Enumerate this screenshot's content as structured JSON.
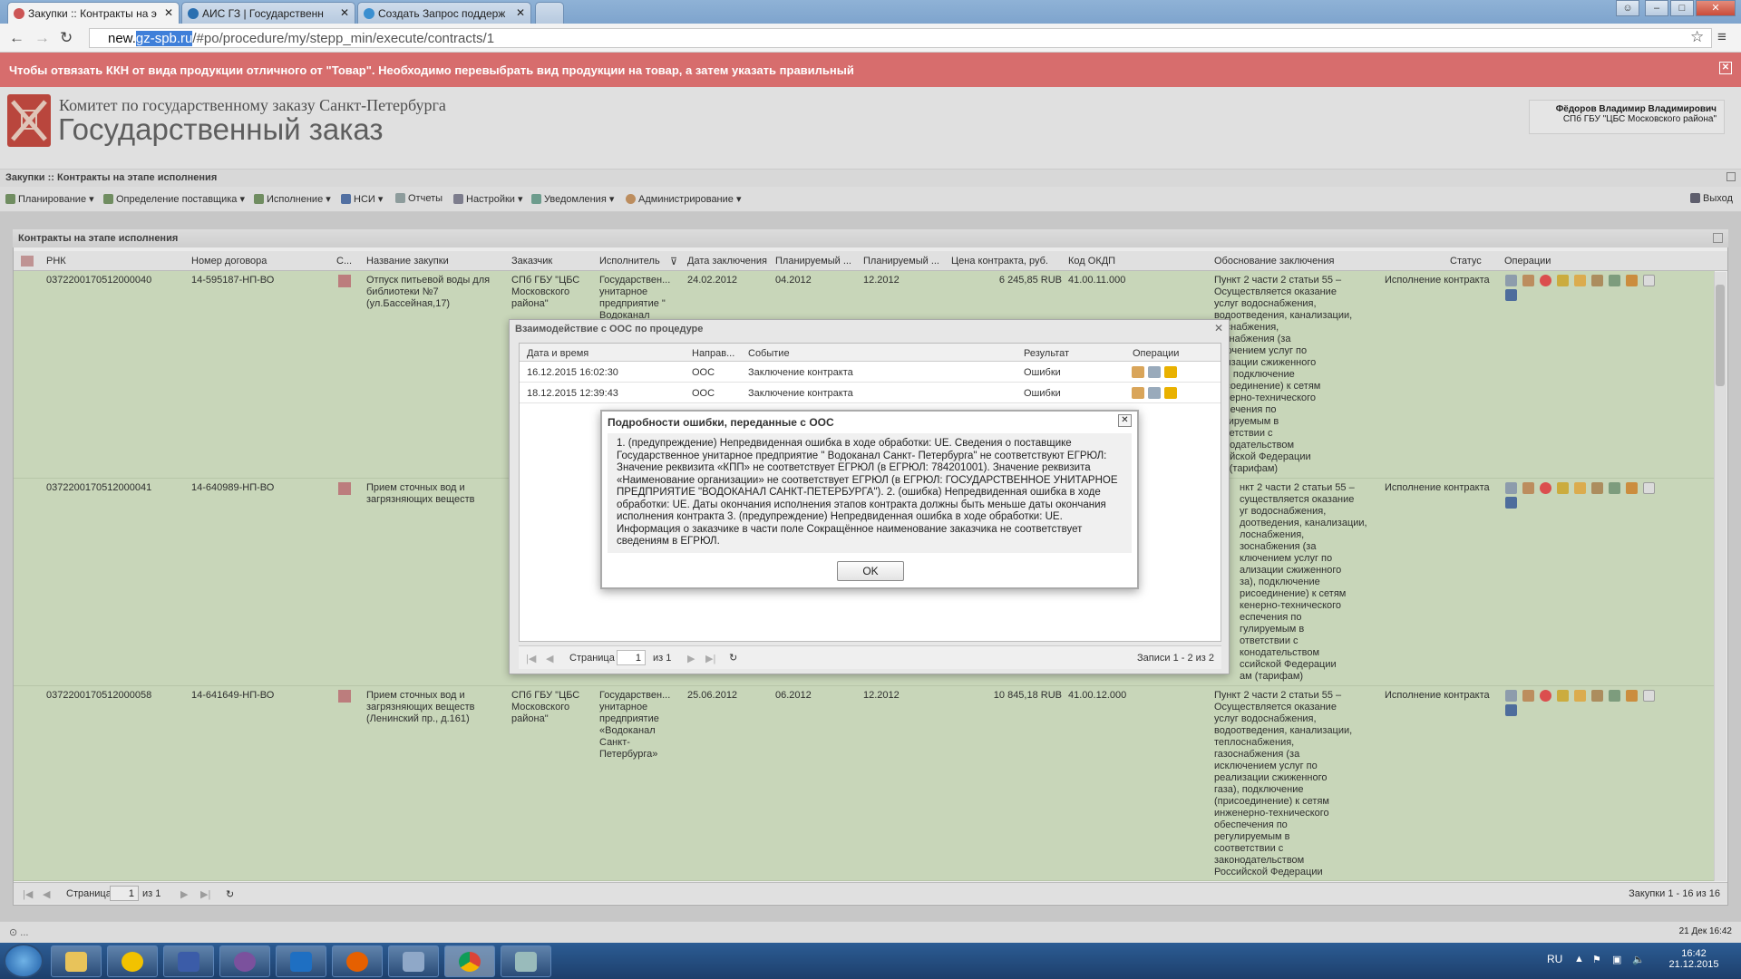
{
  "browser": {
    "tabs": [
      {
        "title": "Закупки :: Контракты на э",
        "active": true
      },
      {
        "title": "АИС ГЗ | Государственн",
        "active": false
      },
      {
        "title": "Создать Запрос поддерж",
        "active": false
      }
    ],
    "url_prefix": "new.",
    "url_highlight": "gz-spb.ru",
    "url_rest": "/#po/procedure/my/stepp_min/execute/contracts/1"
  },
  "alert": {
    "text": "Чтобы отвязать ККН от вида продукции отличного от \"Товар\". Необходимо перевыбрать вид продукции на товар, а затем указать правильный"
  },
  "header": {
    "org_line1": "Комитет по государственному заказу Санкт-Петербурга",
    "org_line2": "Государственный заказ",
    "user_name": "Фёдоров Владимир Владимирович",
    "user_org": "СПб ГБУ \"ЦБС Московского района\""
  },
  "page_title": "Закупки :: Контракты на этапе исполнения",
  "menu": {
    "items": [
      "Планирование",
      "Определение поставщика",
      "Исполнение",
      "НСИ",
      "Отчеты",
      "Настройки",
      "Уведомления",
      "Администрирование"
    ],
    "exit": "Выход"
  },
  "grid": {
    "title": "Контракты на этапе исполнения",
    "columns": [
      "РНК",
      "Номер договора",
      "С...",
      "Название закупки",
      "Заказчик",
      "Исполнитель",
      "Дата заключения",
      "Планируемый ...",
      "Планируемый ...",
      "Цена контракта, руб.",
      "Код ОКДП",
      "Обоснование заключения",
      "Статус",
      "Операции"
    ],
    "rows": [
      {
        "rnk": "0372200170512000040",
        "contract_no": "14-595187-НП-ВО",
        "name": "Отпуск питьевой воды для\nбиблиотеки №7\n(ул.Бассейная,17)",
        "customer": "СПб ГБУ \"ЦБС\nМосковского\nрайона\"",
        "executor": "Государствен...\nунитарное\nпредприятие \"\nВодоканал",
        "date": "24.02.2012",
        "plan1": "04.2012",
        "plan2": "12.2012",
        "price": "6 245,85 RUB",
        "okdp": "41.00.11.000",
        "basis": "Пункт 2 части 2 статьи 55 –\nОсуществляется оказание\nуслуг водоснабжения,\nводоотведения, канализации,\nлоснабжения,\nзоснабжения (за\nключением услуг по\nализации сжиженного\nза), подключение\nрисоединение) к сетям\nкенерно-технического\nеспечения по\nгулируемым в\nответствии с\nконодательством\nссийской Федерации\nам (тарифам)",
        "status": "Исполнение контракта"
      },
      {
        "rnk": "0372200170512000041",
        "contract_no": "14-640989-НП-ВО",
        "name": "Прием сточных вод и\nзагрязняющих веществ",
        "customer": "",
        "executor": "",
        "date": "",
        "plan1": "",
        "plan2": "",
        "price": "",
        "okdp": "",
        "basis": "нкт 2 части 2 статьи 55 –\nсуществляется оказание\nуг водоснабжения,\nдоотведения, канализации,\nлоснабжения,\nзоснабжения (за\nключением услуг по\nализации сжиженного\nза), подключение\nрисоединение) к сетям\nкенерно-технического\nеспечения по\nгулируемым в\nответствии с\nконодательством\nссийской Федерации\nам (тарифам)",
        "status": "Исполнение контракта"
      },
      {
        "rnk": "0372200170512000058",
        "contract_no": "14-641649-НП-ВО",
        "name": "Прием сточных вод и\nзагрязняющих веществ\n(Ленинский пр., д.161)",
        "customer": "СПб ГБУ \"ЦБС\nМосковского\nрайона\"",
        "executor": "Государствен...\nунитарное\nпредприятие\n«Водоканал\nСанкт-\nПетербурга»",
        "date": "25.06.2012",
        "plan1": "06.2012",
        "plan2": "12.2012",
        "price": "10 845,18 RUB",
        "okdp": "41.00.12.000",
        "basis": "Пункт 2 части 2 статьи 55 –\nОсуществляется оказание\nуслуг водоснабжения,\nводоотведения, канализации,\nтеплоснабжения,\nгазоснабжения (за\nисключением услуг по\nреализации сжиженного\nгаза), подключение\n(присоединение) к сетям\nинженерно-технического\nобеспечения по\nрегулируемым в\nсоответствии с\nзаконодательством\nРоссийской Федерации",
        "status": "Исполнение контракта"
      }
    ],
    "pager": {
      "label": "Страница",
      "page": "1",
      "of": "из 1",
      "records": "Закупки 1 - 16 из 16"
    }
  },
  "dialog_ooc": {
    "title": "Взаимодействие с ООС по процедуре",
    "columns": [
      "Дата и время",
      "Направ...",
      "Событие",
      "Результат",
      "Операции"
    ],
    "rows": [
      {
        "datetime": "16.12.2015 16:02:30",
        "direction": "ООС",
        "event": "Заключение контракта",
        "result": "Ошибки"
      },
      {
        "datetime": "18.12.2015 12:39:43",
        "direction": "ООС",
        "event": "Заключение контракта",
        "result": "Ошибки"
      }
    ],
    "pager": {
      "label": "Страница",
      "page": "1",
      "of": "из 1",
      "records": "Записи 1 - 2 из 2"
    }
  },
  "dialog_error": {
    "title": "Подробности ошибки, переданные с ООС",
    "text": "1. (предупреждение) Непредвиденная ошибка в ходе обработки: UE. Сведения о поставщике Государственное унитарное предприятие \" Водоканал Санкт- Петербурга\" не соответствуют ЕГРЮЛ: Значение реквизита «КПП» не соответствует ЕГРЮЛ (в ЕГРЮЛ: 784201001). Значение реквизита «Наименование организации» не соответствует ЕГРЮЛ (в ЕГРЮЛ: ГОСУДАРСТВЕННОЕ УНИТАРНОЕ ПРЕДПРИЯТИЕ \"ВОДОКАНАЛ САНКТ-ПЕТЕРБУРГА\"). 2. (ошибка) Непредвиденная ошибка в ходе обработки: UE. Даты окончания исполнения этапов контракта должны быть меньше даты окончания исполнения контракта 3. (предупреждение) Непредвиденная ошибка в ходе обработки: UE. Информация о заказчике в части поле Сокращённое наименование заказчика не соответствует сведениям в ЕГРЮЛ.",
    "ok": "OK"
  },
  "statusbar": {
    "right": "21 Дек 16:42"
  },
  "taskbar": {
    "lang": "RU",
    "time": "16:42",
    "date": "21.12.2015"
  },
  "colors": {
    "alert": "#d76d6d",
    "row_bg": "#d9e9c9",
    "taskbar": "#1d3f6b"
  }
}
